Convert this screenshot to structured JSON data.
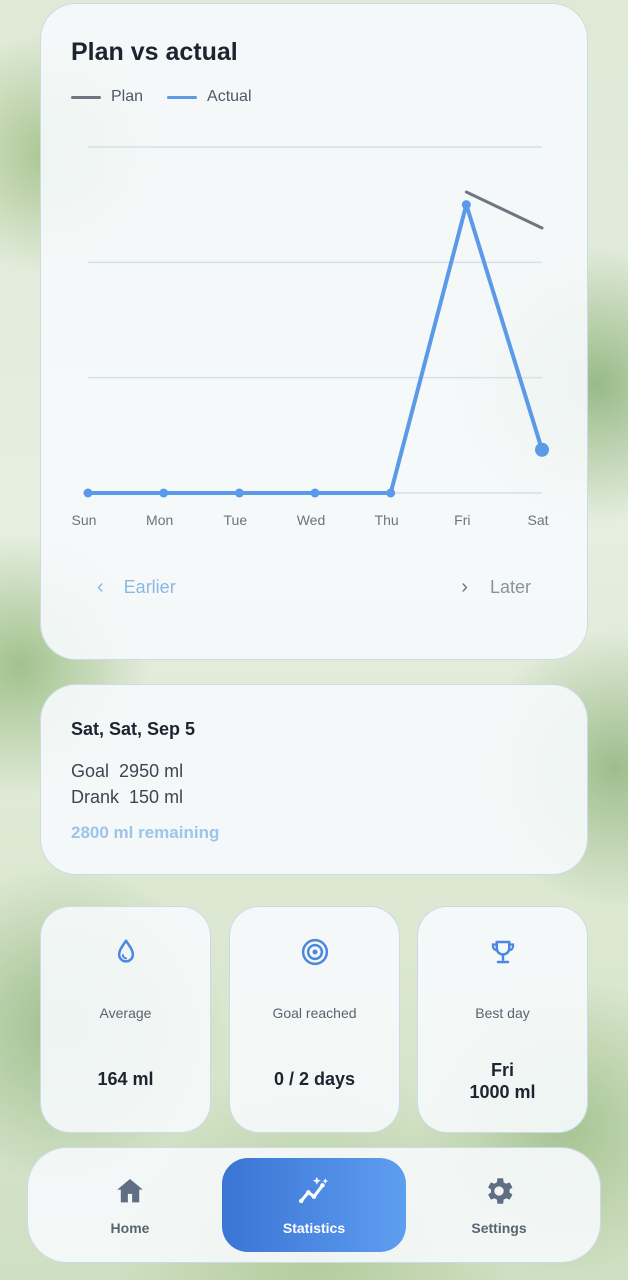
{
  "colors": {
    "plan": "#6f7680",
    "actual": "#5b9ae8",
    "accent": "#4a88e0",
    "grid": "#d4e0ea"
  },
  "chart": {
    "title": "Plan vs actual",
    "legend": {
      "plan": "Plan",
      "actual": "Actual"
    },
    "earlier_label": "Earlier",
    "later_label": "Later"
  },
  "chart_data": {
    "type": "line",
    "title": "Plan vs actual",
    "categories": [
      "Sun",
      "Mon",
      "Tue",
      "Wed",
      "Thu",
      "Fri",
      "Sat"
    ],
    "series": [
      {
        "name": "Plan",
        "values": [
          null,
          null,
          null,
          null,
          null,
          2950,
          2950
        ]
      },
      {
        "name": "Actual",
        "values": [
          0,
          0,
          0,
          0,
          0,
          1000,
          150
        ]
      }
    ],
    "ylim": [
      0,
      1200
    ],
    "grid": true,
    "legend_position": "top-left",
    "clipped_above_top": true
  },
  "day": {
    "title": "Sat, Sat, Sep 5",
    "goal_label": "Goal",
    "goal_value": "2950 ml",
    "drank_label": "Drank",
    "drank_value": "150 ml",
    "remaining": "2800 ml remaining"
  },
  "stats": [
    {
      "icon": "water-drop-icon",
      "label": "Average",
      "value": "164 ml"
    },
    {
      "icon": "target-icon",
      "label": "Goal reached",
      "value": "0 / 2 days"
    },
    {
      "icon": "trophy-icon",
      "label": "Best day",
      "value_line1": "Fri",
      "value_line2": "1000 ml"
    }
  ],
  "nav": [
    {
      "icon": "home-icon",
      "label": "Home",
      "active": false
    },
    {
      "icon": "trend-sparkle-icon",
      "label": "Statistics",
      "active": true
    },
    {
      "icon": "gear-icon",
      "label": "Settings",
      "active": false
    }
  ]
}
